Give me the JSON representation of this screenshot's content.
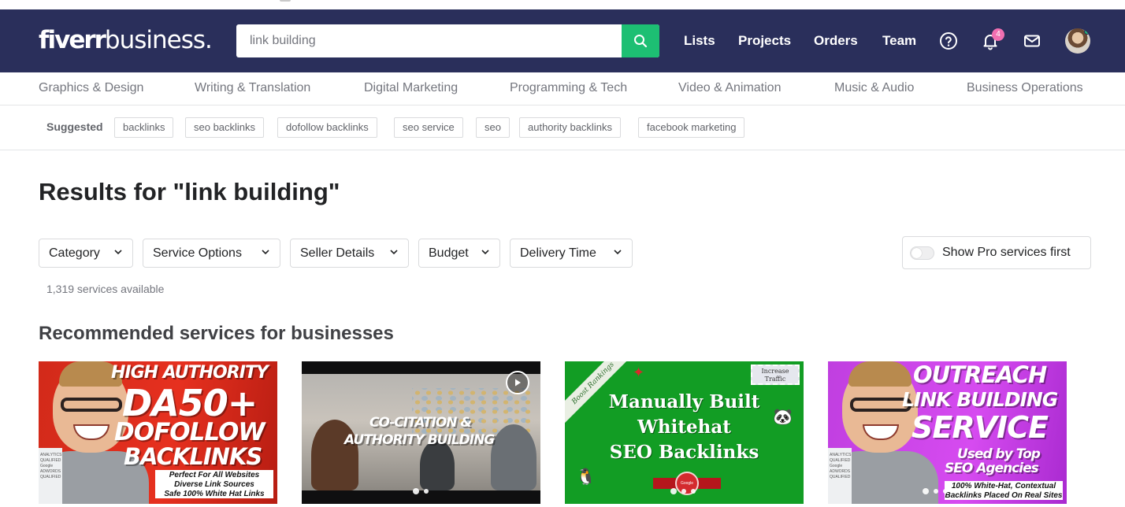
{
  "header": {
    "logo_main": "fiverr",
    "logo_sub": "business.",
    "search": {
      "value": "link building",
      "placeholder": "link building"
    },
    "nav": [
      "Lists",
      "Projects",
      "Orders",
      "Team"
    ],
    "notification_count": "4",
    "icons": [
      "help-icon",
      "bell-icon",
      "mail-icon",
      "avatar"
    ]
  },
  "categories": [
    "Graphics & Design",
    "Writing & Translation",
    "Digital Marketing",
    "Programming & Tech",
    "Video & Animation",
    "Music & Audio",
    "Business Operations"
  ],
  "suggested": {
    "label": "Suggested",
    "chips": [
      "backlinks",
      "seo backlinks",
      "dofollow backlinks",
      "seo service",
      "seo",
      "authority backlinks",
      "facebook marketing"
    ]
  },
  "results_title": "Results for \"link building\"",
  "filters": [
    "Category",
    "Service Options",
    "Seller Details",
    "Budget",
    "Delivery Time"
  ],
  "pro_toggle": {
    "label": "Show Pro services first",
    "on": false
  },
  "services_count": "1,319 services available",
  "recommended_title": "Recommended services for businesses",
  "cards": [
    {
      "lines": [
        "HIGH AUTHORITY",
        "DA50+",
        "DOFOLLOW",
        "BACKLINKS"
      ],
      "sub": [
        "Perfect For All Websites",
        "Diverse Link Sources",
        "Safe 100% White Hat Links"
      ]
    },
    {
      "lines": [
        "CO-CITATION &",
        "AUTHORITY BUILDING"
      ]
    },
    {
      "ribbon": "Boost Rankings",
      "stamp": [
        "Increase",
        "Traffic"
      ],
      "lines": [
        "Manually Built",
        "Whitehat",
        "SEO Backlinks"
      ],
      "seal": "Google"
    },
    {
      "lines": [
        "OUTREACH",
        "LINK BUILDING",
        "SERVICE",
        "Used by Top",
        "SEO Agencies"
      ],
      "sub": [
        "100% White-Hat, Contextual",
        "Backlinks Placed On Real Sites"
      ]
    }
  ],
  "colors": {
    "header_bg": "#2a2f5b",
    "accent": "#1dbf73",
    "badge": "#f06fb1"
  }
}
